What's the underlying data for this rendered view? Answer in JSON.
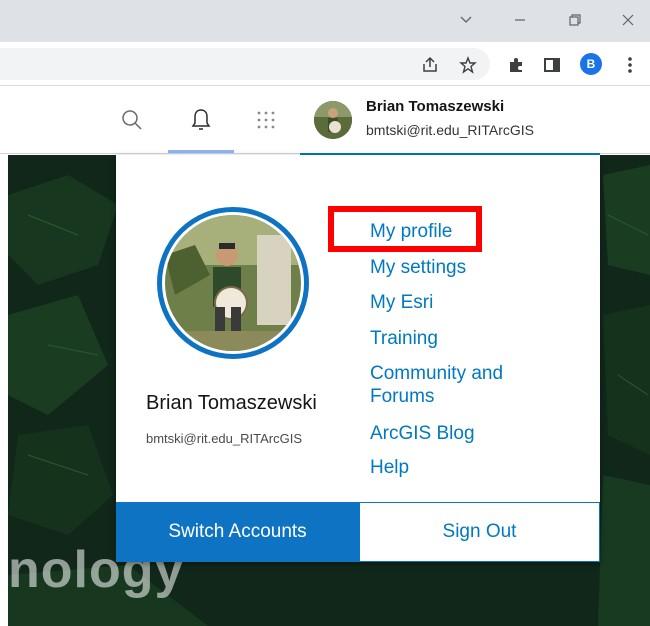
{
  "browser": {
    "profile_initial": "B"
  },
  "header": {
    "user_name": "Brian Tomaszewski",
    "username": "bmtski@rit.edu_RITArcGIS"
  },
  "background": {
    "map_text": "nology"
  },
  "menu": {
    "user_name": "Brian Tomaszewski",
    "username": "bmtski@rit.edu_RITArcGIS",
    "links": {
      "my_profile": "My profile",
      "my_settings": "My settings",
      "my_esri": "My Esri",
      "training": "Training",
      "community_line1": "Community and",
      "community_line2": "Forums",
      "arcgis_blog": "ArcGIS Blog",
      "help": "Help"
    },
    "switch_accounts": "Switch Accounts",
    "sign_out": "Sign Out"
  },
  "colors": {
    "accent": "#0079c1",
    "button_blue": "#0f73c3",
    "highlight": "#ff0000"
  }
}
